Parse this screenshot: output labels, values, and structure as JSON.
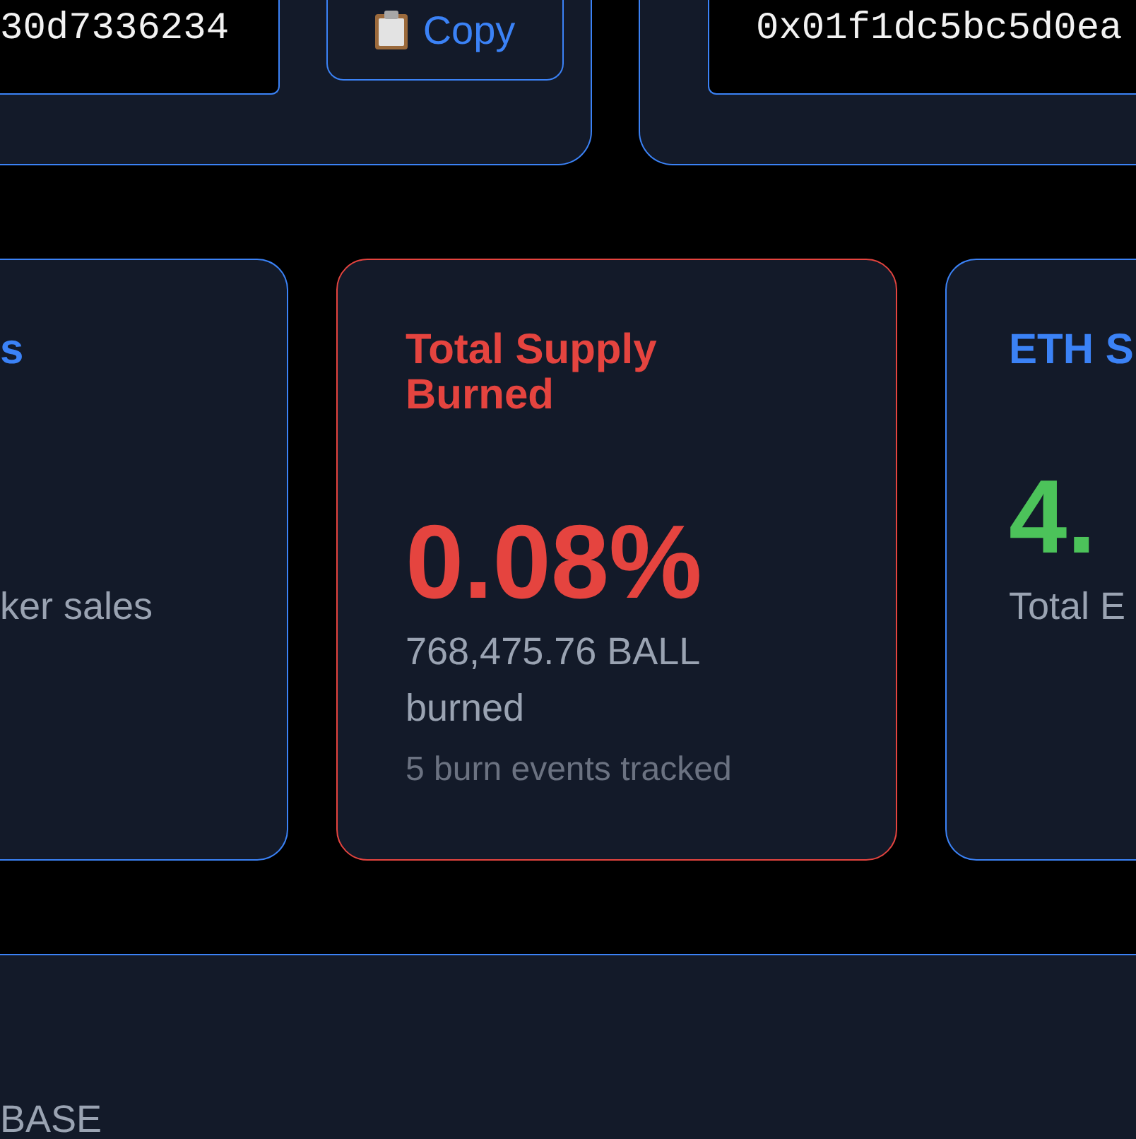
{
  "contract_panels": [
    {
      "address": "30d7336234",
      "copy_button": {
        "label": "Copy"
      }
    },
    {
      "address": "0x01f1dc5bc5d0ea"
    }
  ],
  "stat_cards": [
    {
      "kind": "standard",
      "title": "s",
      "subtitle": "ker sales"
    },
    {
      "kind": "highlight",
      "title": "Total Supply Burned",
      "value": "0.08%",
      "subtitle": "768,475.76 BALL burned",
      "note": "5 burn events tracked"
    },
    {
      "kind": "standard",
      "title": "ETH S",
      "value": "4.",
      "subtitle": "Total E"
    }
  ],
  "bottom_panel": {
    "label": "BASE"
  }
}
